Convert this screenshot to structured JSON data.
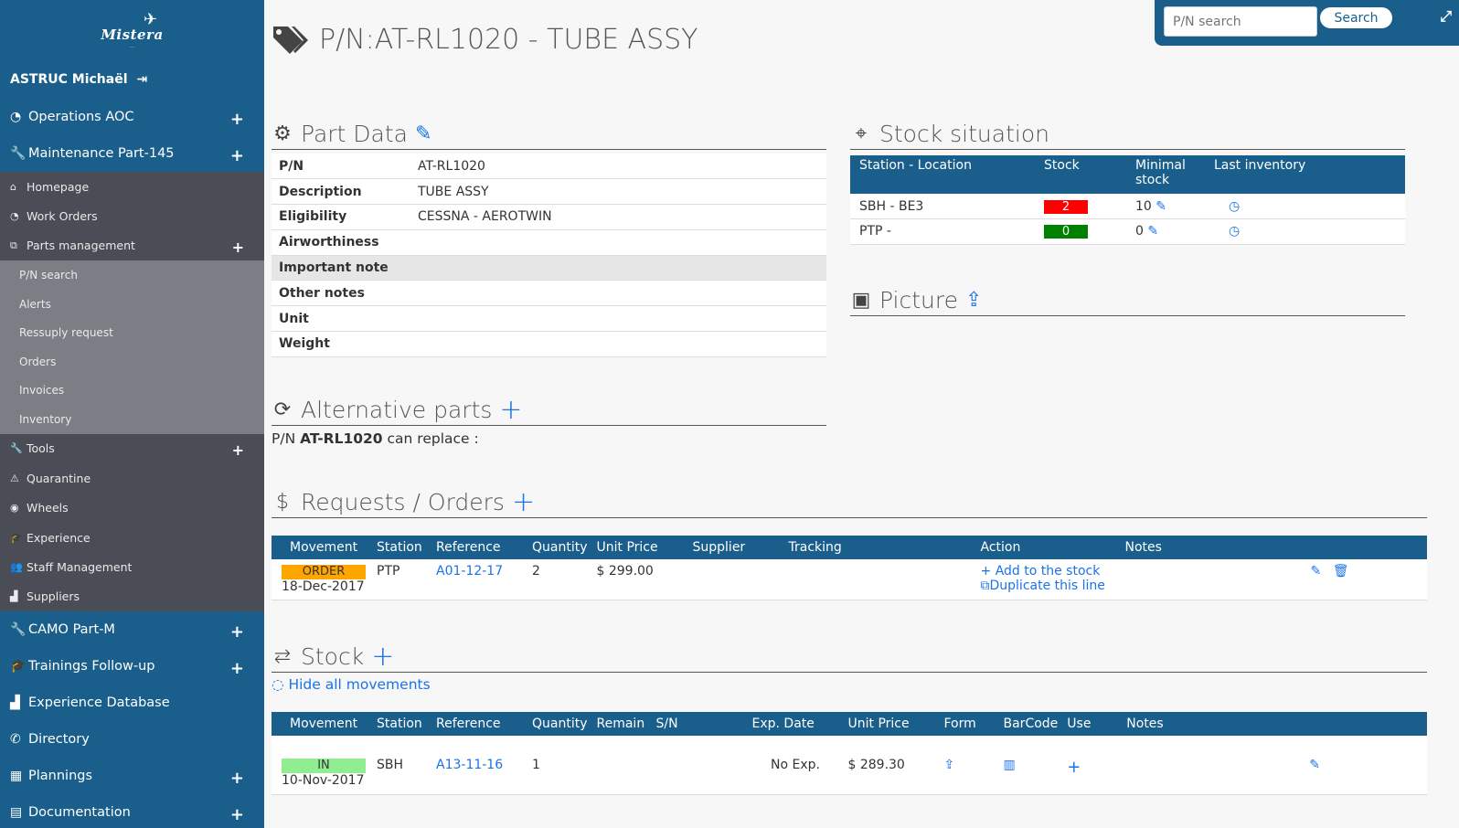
{
  "app": {
    "logo_text": "Mistera",
    "user_name": "ASTRUC Michaël"
  },
  "sidebar": {
    "top_items": [
      {
        "label": "Operations AOC",
        "icon": "dashboard-icon",
        "expandable": true
      },
      {
        "label": "Maintenance Part-145",
        "icon": "wrench-icon",
        "expandable": true
      }
    ],
    "sub_items": [
      {
        "label": "Homepage",
        "icon": "home-icon"
      },
      {
        "label": "Work Orders",
        "icon": "dashboard-icon"
      },
      {
        "label": "Parts management",
        "icon": "tags-icon",
        "expandable": true
      }
    ],
    "parts_items": [
      "P/N search",
      "Alerts",
      "Ressuply request",
      "Orders",
      "Invoices",
      "Inventory"
    ],
    "sub_items_2": [
      {
        "label": "Tools",
        "icon": "wrench-icon",
        "expandable": true
      },
      {
        "label": "Quarantine",
        "icon": "warning-icon"
      },
      {
        "label": "Wheels",
        "icon": "wheel-icon"
      },
      {
        "label": "Experience",
        "icon": "graduation-cap-icon"
      },
      {
        "label": "Staff Management",
        "icon": "users-icon"
      },
      {
        "label": "Suppliers",
        "icon": "chart-icon"
      }
    ],
    "bottom_items": [
      {
        "label": "CAMO Part-M",
        "icon": "wrench-icon",
        "expandable": true
      },
      {
        "label": "Trainings Follow-up",
        "icon": "graduation-cap-icon",
        "expandable": true
      },
      {
        "label": "Experience Database",
        "icon": "chart-icon",
        "expandable": false
      },
      {
        "label": "Directory",
        "icon": "phone-icon",
        "expandable": false
      },
      {
        "label": "Plannings",
        "icon": "calendar-icon",
        "expandable": true
      },
      {
        "label": "Documentation",
        "icon": "book-icon",
        "expandable": true
      }
    ]
  },
  "header": {
    "title": "P/N:AT-RL1020 - TUBE ASSY",
    "search_placeholder": "P/N search",
    "search_button": "Search"
  },
  "part_data": {
    "title": "Part Data",
    "rows": [
      {
        "key": "P/N",
        "value": "AT-RL1020"
      },
      {
        "key": "Description",
        "value": "TUBE ASSY"
      },
      {
        "key": "Eligibility",
        "value": "CESSNA - AEROTWIN"
      },
      {
        "key": "Airworthiness",
        "value": ""
      },
      {
        "key": "Important note",
        "value": ""
      },
      {
        "key": "Other notes",
        "value": ""
      },
      {
        "key": "Unit",
        "value": ""
      },
      {
        "key": "Weight",
        "value": ""
      }
    ]
  },
  "stock_situation": {
    "title": "Stock situation",
    "headers": [
      "Station - Location",
      "Stock",
      "Minimal stock",
      "Last inventory"
    ],
    "rows": [
      {
        "location": "SBH - BE3",
        "stock": "2",
        "stock_color": "#ff0000",
        "minimal": "10"
      },
      {
        "location": "PTP -",
        "stock": "0",
        "stock_color": "#008000",
        "minimal": "0"
      }
    ]
  },
  "picture": {
    "title": "Picture"
  },
  "alternative": {
    "title": "Alternative parts",
    "prefix": "P/N",
    "pn": "AT-RL1020",
    "suffix": "can replace :"
  },
  "requests": {
    "title": "Requests / Orders",
    "headers": [
      "Movement",
      "Station",
      "Reference",
      "Quantity",
      "Unit Price",
      "Supplier",
      "Tracking",
      "Action",
      "Notes"
    ],
    "rows": [
      {
        "movement": "ORDER",
        "date": "18-Dec-2017",
        "station": "PTP",
        "reference": "A01-12-17",
        "quantity": "2",
        "unit_price": "$ 299.00",
        "action_1": "Add to the stock",
        "action_2": "Duplicate this line"
      }
    ]
  },
  "stock": {
    "title": "Stock",
    "hide_link": "Hide all movements",
    "headers": [
      "Movement",
      "Station",
      "Reference",
      "Quantity",
      "Remain",
      "S/N",
      "Exp. Date",
      "Unit Price",
      "Form",
      "BarCode",
      "Use",
      "Notes"
    ],
    "rows": [
      {
        "movement": "IN",
        "date": "10-Nov-2017",
        "station": "SBH",
        "reference": "A13-11-16",
        "quantity": "1",
        "exp_date": "No Exp.",
        "unit_price": "$ 289.30"
      }
    ]
  },
  "colors": {
    "sidebar": "#1a5f8c",
    "sidebar_sub": "#4a4d55",
    "sidebar_sub2": "#7b7e85",
    "accent": "#1a73e8",
    "order_badge": "#ffa500",
    "in_badge": "#90ee90"
  }
}
